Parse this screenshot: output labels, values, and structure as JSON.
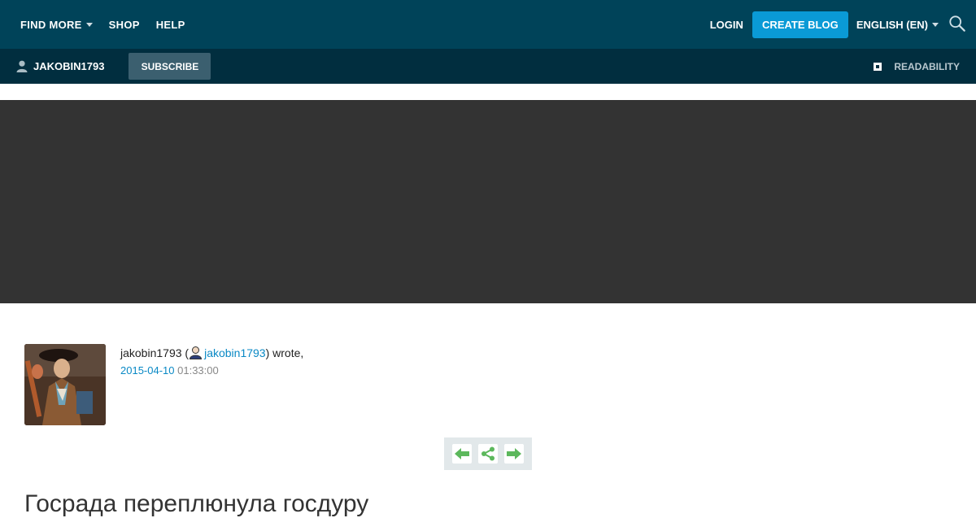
{
  "topbar": {
    "find_more": "FIND MORE",
    "shop": "SHOP",
    "help": "HELP",
    "login": "LOGIN",
    "create_blog": "CREATE BLOG",
    "language": "ENGLISH (EN)"
  },
  "subbar": {
    "username": "JAKOBIN1793",
    "subscribe": "SUBSCRIBE",
    "readability": "READABILITY"
  },
  "post": {
    "author_name": "jakobin1793",
    "author_link": "jakobin1793",
    "wrote_suffix": ") wrote,",
    "open_paren": " (",
    "date": "2015-04-10",
    "time": "01:33:00",
    "title": "Госрада переплюнула госдуру"
  },
  "colors": {
    "topbar": "#004359",
    "subbar": "#012e3f",
    "accent": "#0a9ad6",
    "banner": "#333333",
    "nav_icons": "#5cb85c"
  }
}
